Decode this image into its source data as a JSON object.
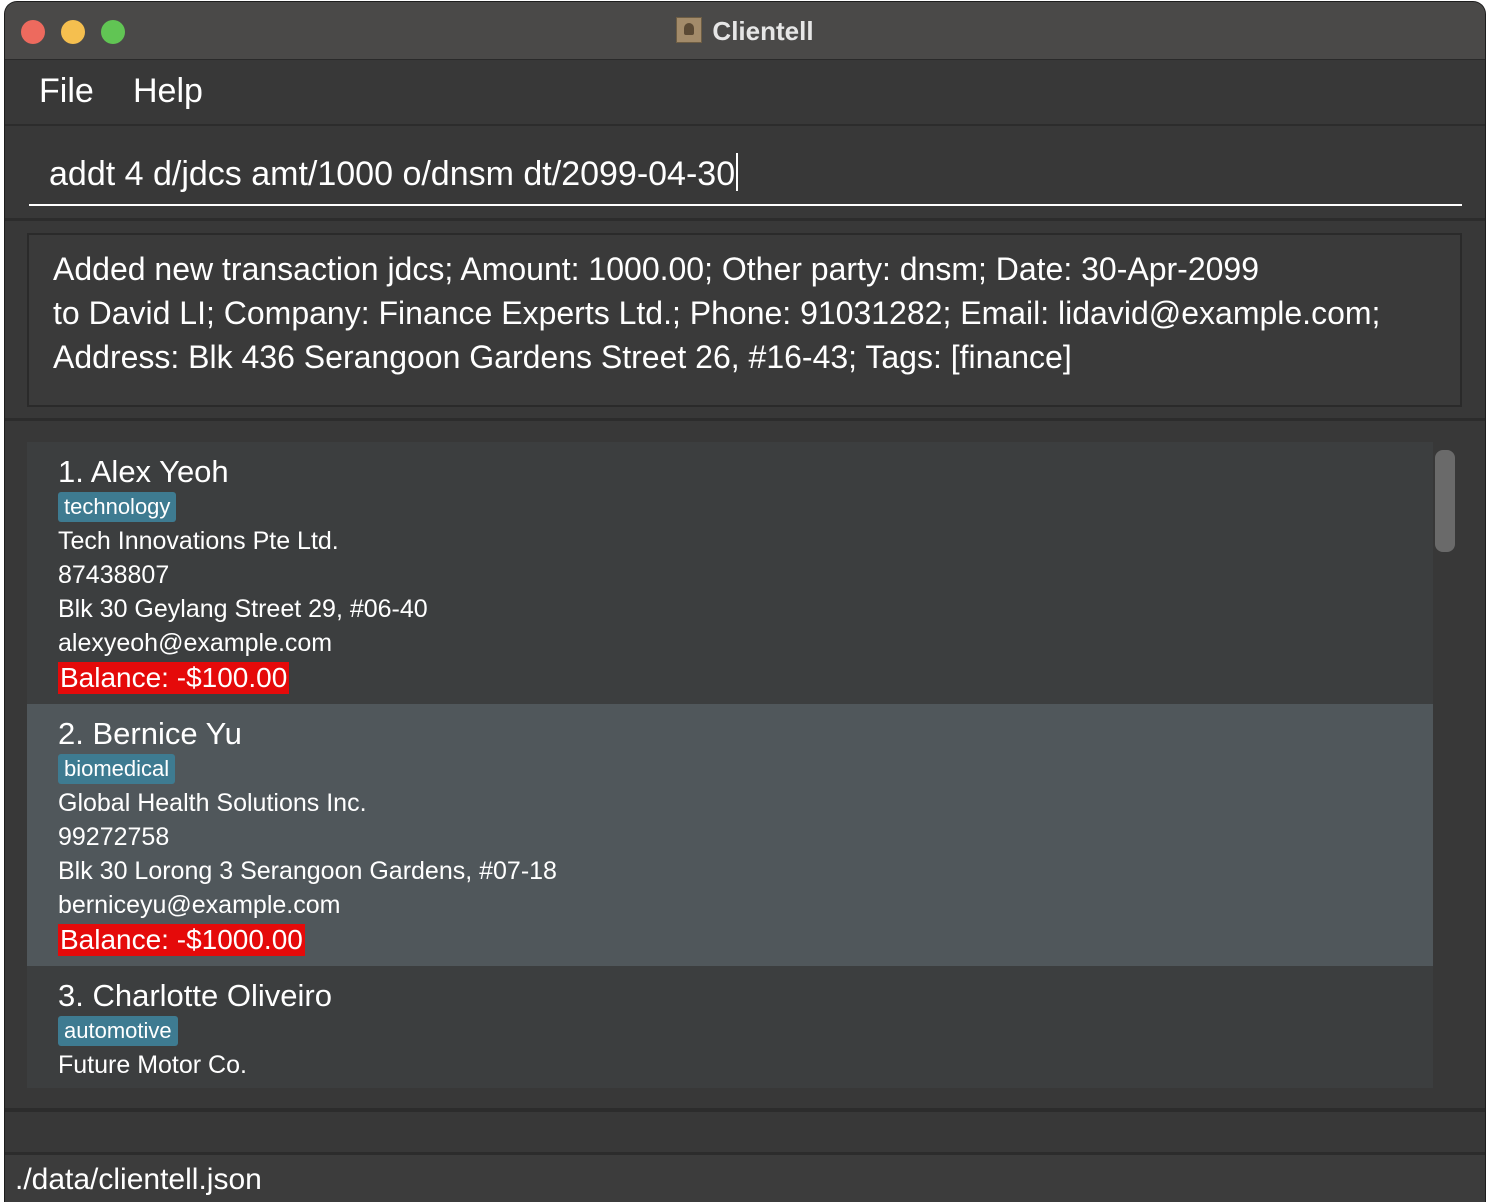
{
  "window": {
    "title": "Clientell"
  },
  "menu": {
    "file": "File",
    "help": "Help"
  },
  "command": {
    "value": "addt 4 d/jdcs amt/1000 o/dnsm dt/2099-04-30"
  },
  "result": {
    "lines": [
      "Added new transaction jdcs; Amount: 1000.00; Other party: dnsm; Date: 30-Apr-2099",
      "to David LI; Company: Finance Experts Ltd.; Phone: 91031282; Email: lidavid@example.com;",
      "Address: Blk 436 Serangoon Gardens Street 26, #16-43; Tags: [finance]"
    ]
  },
  "clients": [
    {
      "name": "1. Alex Yeoh",
      "tag": "technology",
      "company": "Tech Innovations Pte Ltd.",
      "phone": "87438807",
      "address": "Blk 30 Geylang Street 29, #06-40",
      "email": "alexyeoh@example.com",
      "balance": "Balance: -$100.00"
    },
    {
      "name": "2. Bernice Yu",
      "tag": "biomedical",
      "company": "Global Health Solutions Inc.",
      "phone": "99272758",
      "address": "Blk 30 Lorong 3 Serangoon Gardens, #07-18",
      "email": "berniceyu@example.com",
      "balance": "Balance: -$1000.00"
    },
    {
      "name": "3. Charlotte Oliveiro",
      "tag": "automotive",
      "company": "Future Motor Co."
    }
  ],
  "status": {
    "file_path": "./data/clientell.json"
  },
  "colors": {
    "tag": "#3e7b91",
    "balance_negative": "#e50a0a",
    "selected_row": "#50575b"
  }
}
